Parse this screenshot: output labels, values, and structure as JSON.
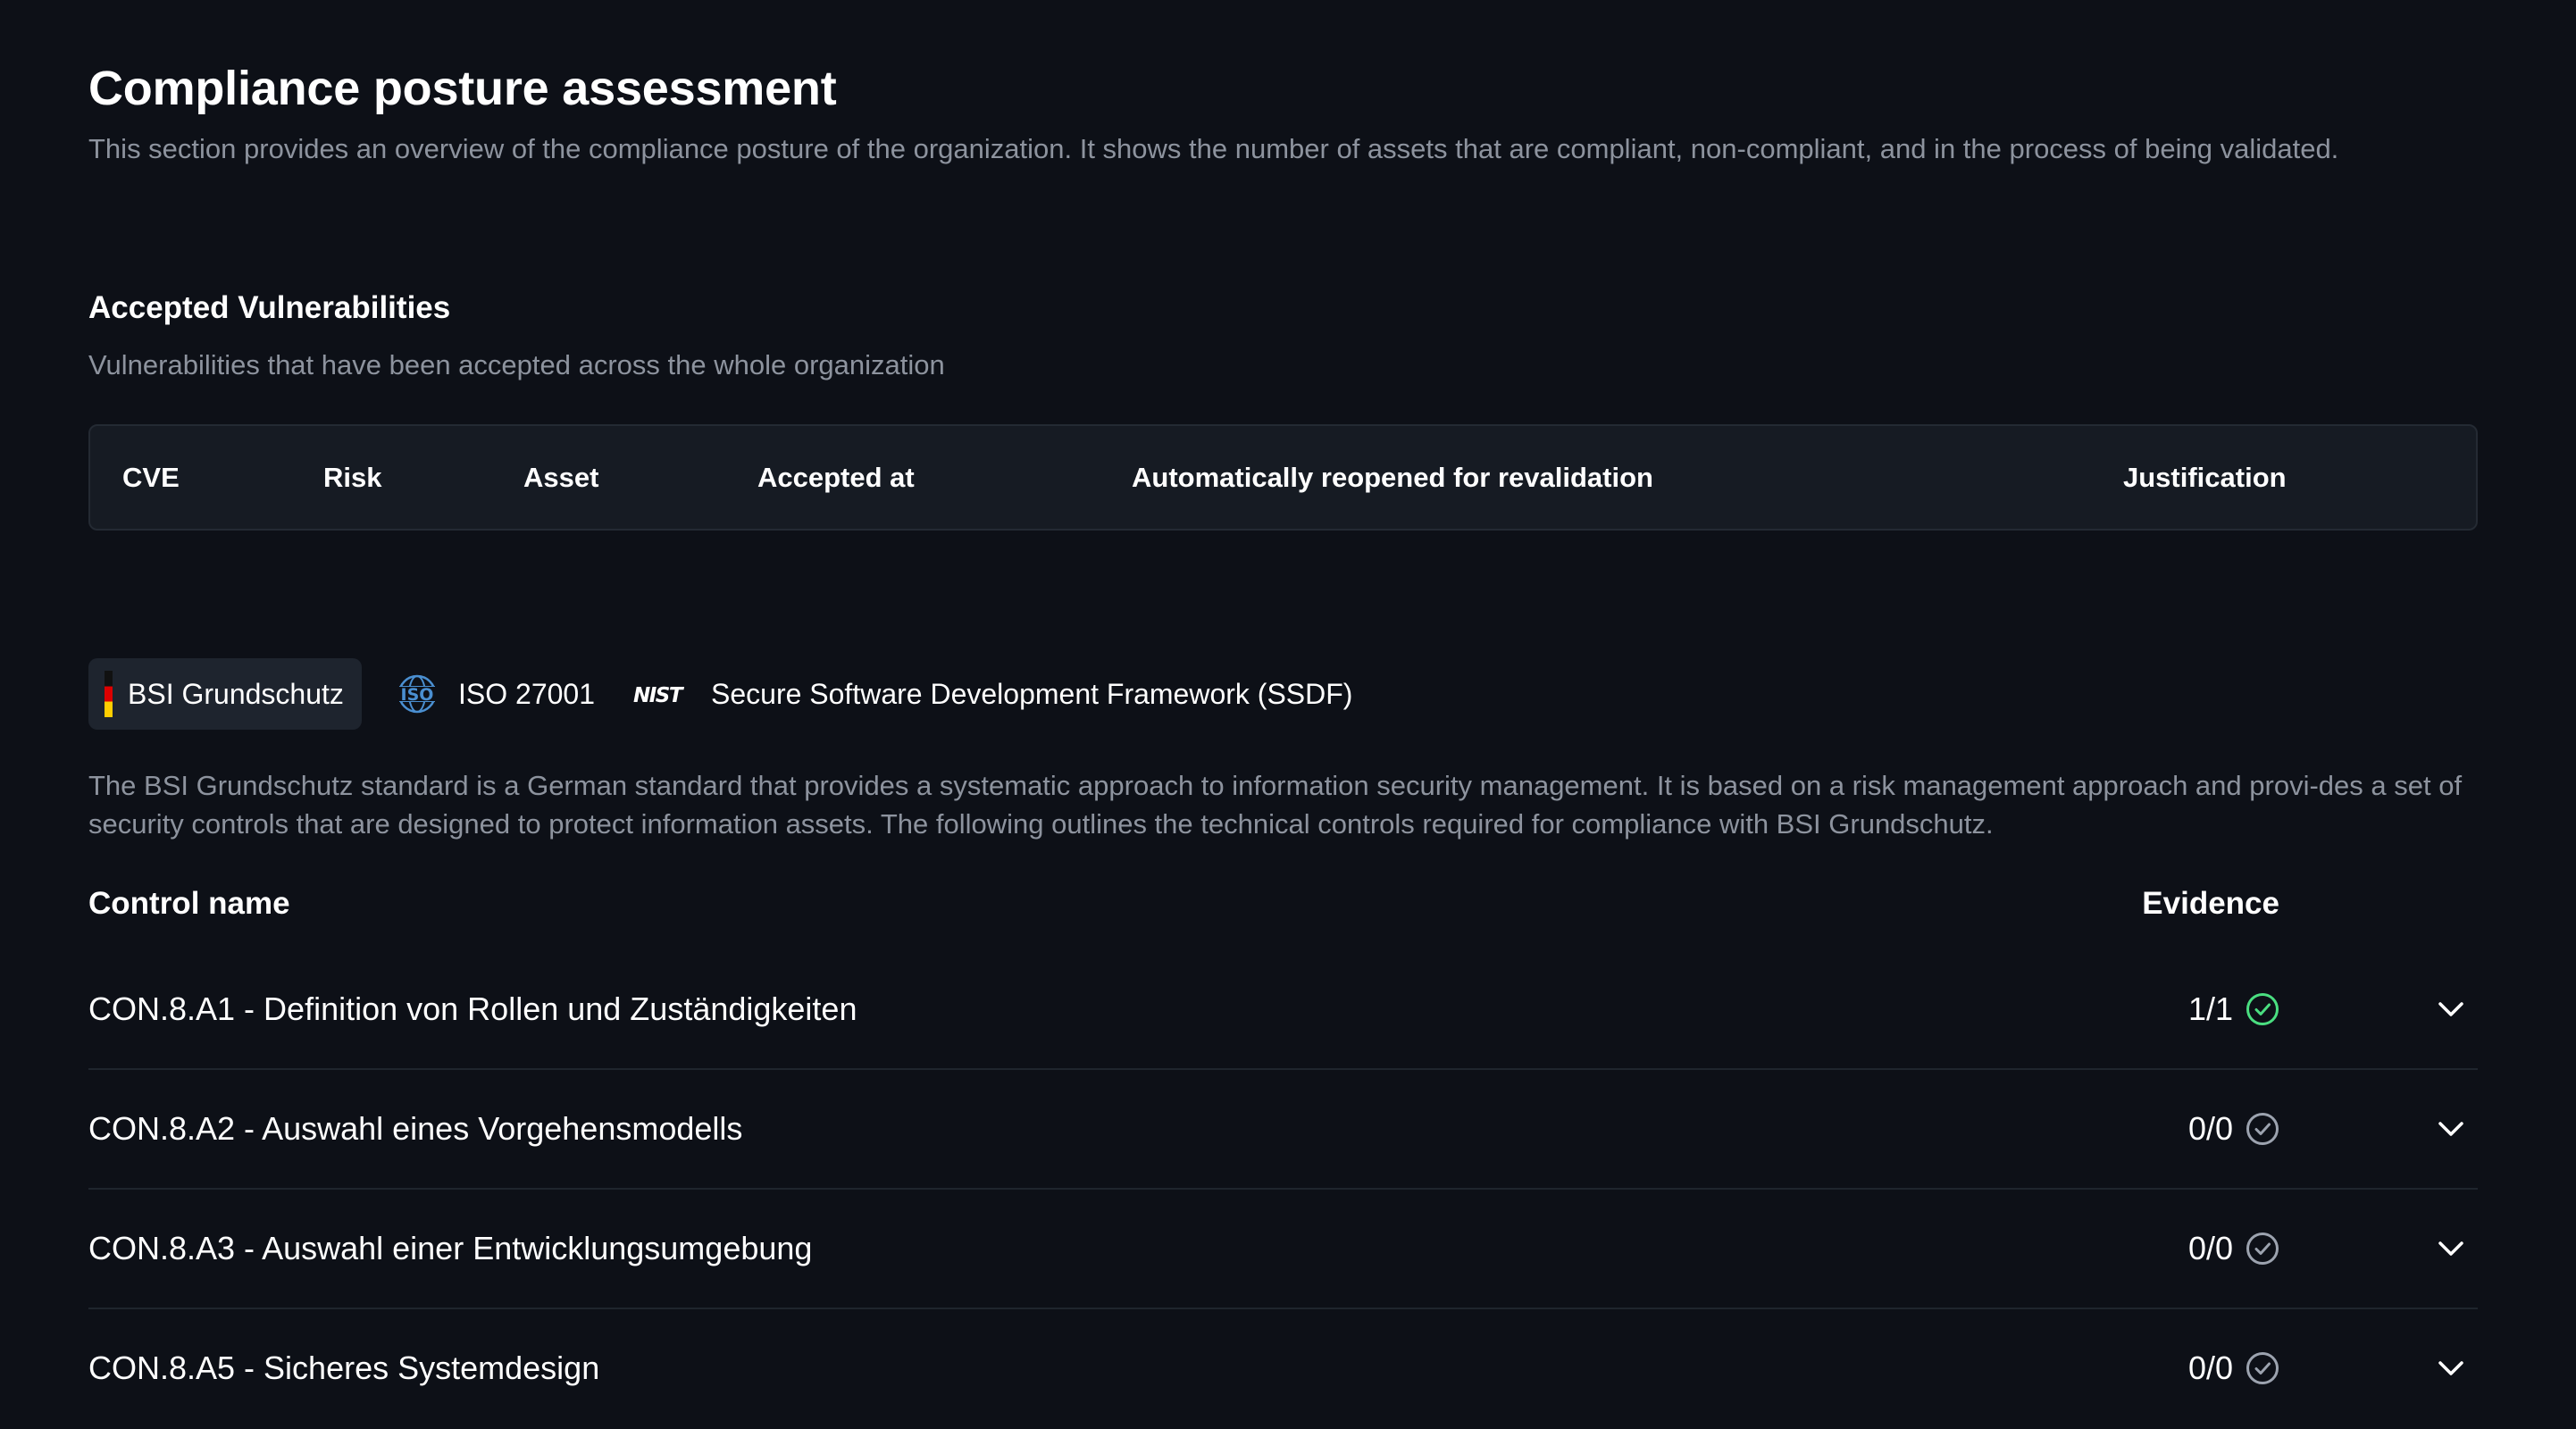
{
  "header": {
    "title": "Compliance posture assessment",
    "description": "This section provides an overview of the compliance posture of the organization. It shows the number of assets that are compliant, non-compliant, and in the process of being validated."
  },
  "accepted_vulnerabilities": {
    "title": "Accepted Vulnerabilities",
    "description": "Vulnerabilities that have been accepted across the whole organization",
    "columns": [
      "CVE",
      "Risk",
      "Asset",
      "Accepted at",
      "Automatically reopened for revalidation",
      "Justification"
    ]
  },
  "frameworks": {
    "tabs": [
      {
        "label": "BSI Grundschutz",
        "icon": "germany-flag-icon",
        "active": true
      },
      {
        "label": "ISO 27001",
        "icon": "iso-logo-icon",
        "active": false
      },
      {
        "label": "Secure Software Development Framework (SSDF)",
        "icon": "nist-logo-icon",
        "active": false
      }
    ],
    "description": "The BSI Grundschutz standard is a German standard that provides a systematic approach to information security management. It is based on a risk management approach and provi-des a set of security controls that are designed to protect information assets. The following outlines the technical controls required for compliance with BSI Grundschutz."
  },
  "controls": {
    "header": {
      "name": "Control name",
      "evidence": "Evidence"
    },
    "rows": [
      {
        "name": "CON.8.A1 - Definition von Rollen und Zuständigkeiten",
        "evidence": "1/1",
        "status": "complete"
      },
      {
        "name": "CON.8.A2 - Auswahl eines Vorgehensmodells",
        "evidence": "0/0",
        "status": "none"
      },
      {
        "name": "CON.8.A3 - Auswahl einer Entwicklungsumgebung",
        "evidence": "0/0",
        "status": "none"
      },
      {
        "name": "CON.8.A5 - Sicheres Systemdesign",
        "evidence": "0/0",
        "status": "none"
      }
    ]
  },
  "colors": {
    "background": "#0d1017",
    "muted_text": "#8d939e",
    "success": "#4ade80",
    "neutral_icon": "#9ca3af"
  }
}
